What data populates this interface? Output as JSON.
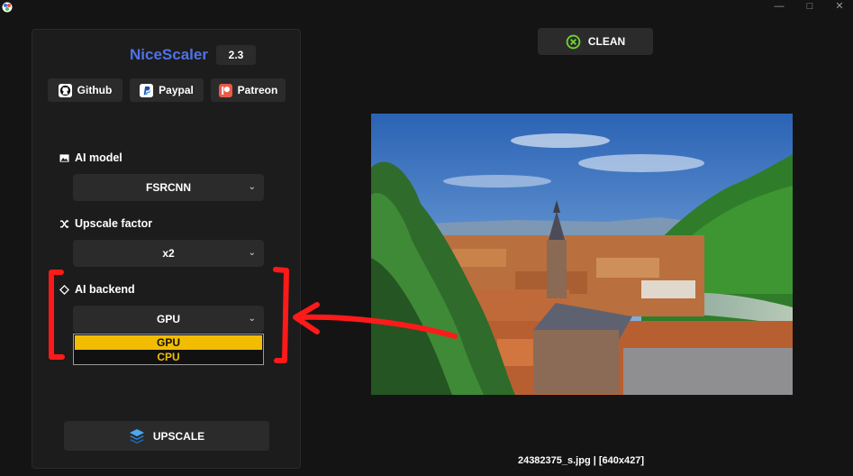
{
  "app": {
    "name": "NiceScaler",
    "version": "2.3"
  },
  "window_controls": {
    "minimize": "—",
    "maximize": "□",
    "close": "✕"
  },
  "links": [
    {
      "label": "Github",
      "icon": "github-icon"
    },
    {
      "label": "Paypal",
      "icon": "paypal-icon"
    },
    {
      "label": "Patreon",
      "icon": "patreon-icon"
    }
  ],
  "settings": {
    "ai_model": {
      "label": "AI model",
      "icon": "image-icon",
      "value": "FSRCNN"
    },
    "upscale_factor": {
      "label": "Upscale factor",
      "icon": "shuffle-icon",
      "value": "x2"
    },
    "ai_backend": {
      "label": "AI backend",
      "icon": "diamond-icon",
      "value": "GPU",
      "options": [
        "GPU",
        "CPU"
      ],
      "highlighted": "GPU"
    }
  },
  "actions": {
    "upscale": "UPSCALE",
    "clean": "CLEAN"
  },
  "preview": {
    "file_info": "24382375_s.jpg | [640x427]"
  },
  "colors": {
    "accent_title": "#4f72e8",
    "dropdown_highlight": "#f2bd00",
    "clean_icon": "#6ed12e",
    "annotation": "#ff1a1a"
  }
}
